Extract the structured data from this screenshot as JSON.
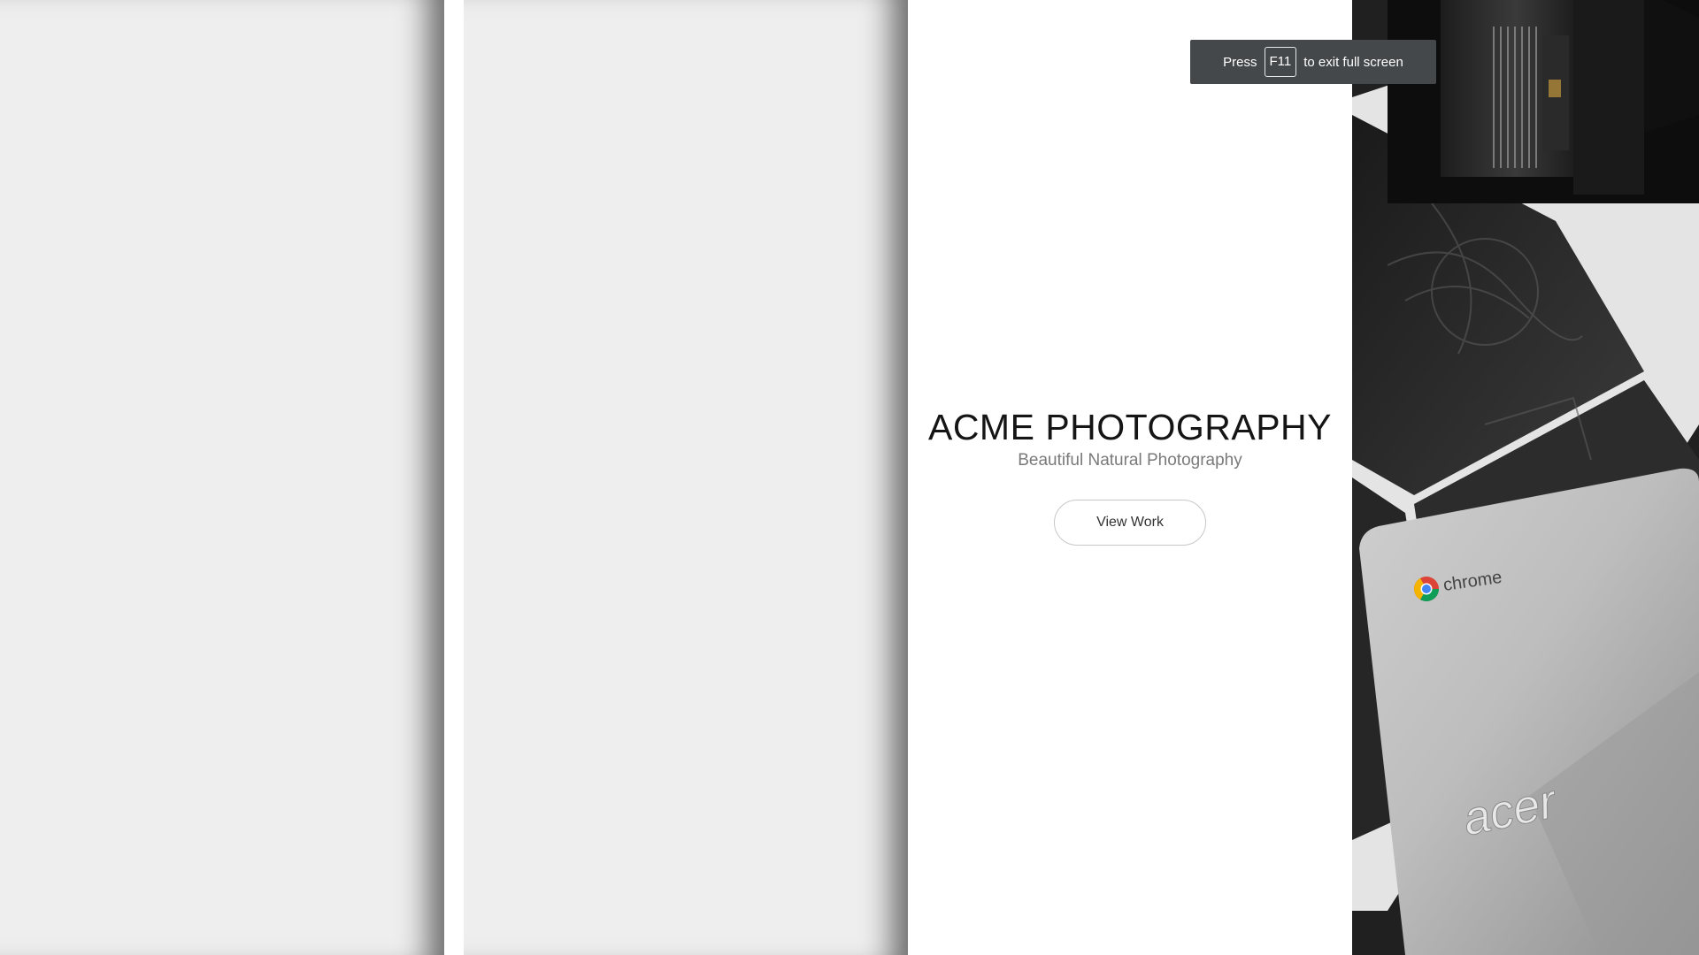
{
  "hero": {
    "title": "ACME PHOTOGRAPHY",
    "subtitle": "Beautiful Natural Photography",
    "cta_label": "View Work"
  },
  "fullscreen_toast": {
    "prefix": "Press",
    "key": "F11",
    "suffix": "to exit full screen"
  },
  "photo": {
    "laptop_brand": "acer",
    "os_label": "chrome",
    "icons": [
      "camera-lens",
      "chrome-logo"
    ]
  },
  "colors": {
    "panel_grey": "#eeeeee",
    "toast_bg": "#45484b",
    "title_text": "#151515",
    "subtitle_text": "#7a7a7a"
  }
}
